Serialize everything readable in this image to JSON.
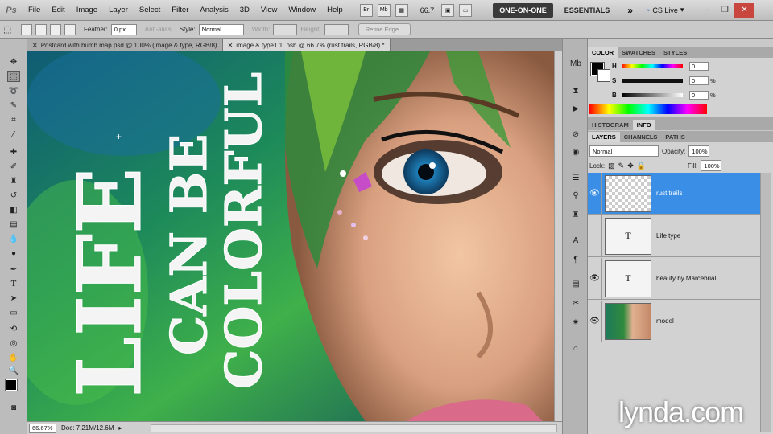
{
  "menubar": {
    "logo": "Ps",
    "items": [
      "File",
      "Edit",
      "Image",
      "Layer",
      "Select",
      "Filter",
      "Analysis",
      "3D",
      "View",
      "Window",
      "Help"
    ],
    "bridge_btn": "Br",
    "minibridge_btn": "Mb",
    "zoom": "66.7",
    "workspace_active": "ONE-ON-ONE",
    "workspace_2": "ESSENTIALS",
    "more": "»",
    "cslive": "CS Live"
  },
  "options": {
    "feather_label": "Feather:",
    "feather_value": "0 px",
    "antialias_label": "Anti-alias",
    "style_label": "Style:",
    "style_value": "Normal",
    "width_label": "Width:",
    "height_label": "Height:",
    "refine_edge": "Refine Edge..."
  },
  "tabs": [
    {
      "label": "Postcard with bumb map.psd @ 100% (image & type, RGB/8)"
    },
    {
      "label": "image & type1 1 .psb @ 66.7% (rust trails, RGB/8) *"
    }
  ],
  "artwork": {
    "line1": "LIFE",
    "line2": "CAN BE",
    "line3": "COLORFUL"
  },
  "status": {
    "zoom": "66.67%",
    "doc": "Doc: 7.21M/12.6M"
  },
  "color_panel": {
    "tabs": [
      "COLOR",
      "SWATCHES",
      "STYLES"
    ],
    "sliders": [
      {
        "label": "H",
        "value": "0",
        "unit": ""
      },
      {
        "label": "S",
        "value": "0",
        "unit": "%"
      },
      {
        "label": "B",
        "value": "0",
        "unit": "%"
      }
    ]
  },
  "hist_panel": {
    "tabs": [
      "HISTOGRAM",
      "INFO"
    ]
  },
  "layers_panel": {
    "tabs": [
      "LAYERS",
      "CHANNELS",
      "PATHS"
    ],
    "blend_mode": "Normal",
    "opacity_label": "Opacity:",
    "opacity": "100%",
    "lock_label": "Lock:",
    "fill_label": "Fill:",
    "fill": "100%",
    "layers": [
      {
        "name": "rust trails",
        "thumb": "",
        "visible": true,
        "selected": true
      },
      {
        "name": "Life type",
        "thumb": "T",
        "visible": false,
        "selected": false
      },
      {
        "name": "beauty by Marcêbrial",
        "thumb": "T",
        "visible": true,
        "selected": false
      },
      {
        "name": "model",
        "thumb": "",
        "visible": true,
        "selected": false
      }
    ]
  },
  "watermark": "lynda.com",
  "colors": {
    "accent": "#3a8ee6",
    "close": "#c8463d"
  }
}
